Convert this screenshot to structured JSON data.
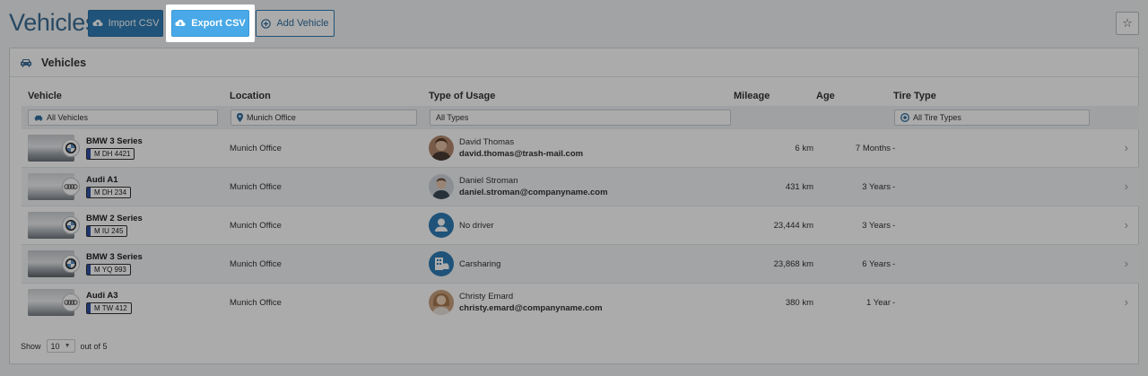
{
  "header": {
    "title": "Vehicles",
    "import_label": "Import CSV",
    "export_label": "Export CSV",
    "add_label": "Add Vehicle",
    "star_icon": "☆"
  },
  "panel": {
    "title": "Vehicles"
  },
  "columns": [
    "Vehicle",
    "Location",
    "Type of Usage",
    "Mileage",
    "Age",
    "Tire Type"
  ],
  "filters": {
    "vehicle": "All Vehicles",
    "location": "Munich Office",
    "usage": "All Types",
    "tire": "All Tire Types"
  },
  "rows": [
    {
      "name": "BMW 3 Series",
      "plate": "M DH 4421",
      "location": "Munich Office",
      "driver": "David Thomas",
      "email": "david.thomas@trash-mail.com",
      "mileage": "6 km",
      "age": "7 Months",
      "tire": "-"
    },
    {
      "name": "Audi A1",
      "plate": "M DH 234",
      "location": "Munich Office",
      "driver": "Daniel Stroman",
      "email": "daniel.stroman@companyname.com",
      "mileage": "431 km",
      "age": "3 Years",
      "tire": "-"
    },
    {
      "name": "BMW 2 Series",
      "plate": "M IU 245",
      "location": "Munich Office",
      "driver": "No driver",
      "email": "",
      "mileage": "23,444 km",
      "age": "3 Years",
      "tire": "-"
    },
    {
      "name": "BMW 3 Series",
      "plate": "M YQ 993",
      "location": "Munich Office",
      "driver": "Carsharing",
      "email": "",
      "mileage": "23,868 km",
      "age": "6 Years",
      "tire": "-"
    },
    {
      "name": "Audi A3",
      "plate": "M TW 412",
      "location": "Munich Office",
      "driver": "Christy Emard",
      "email": "christy.emard@companyname.com",
      "mileage": "380 km",
      "age": "1 Year",
      "tire": "-"
    }
  ],
  "footer": {
    "show_label": "Show",
    "page_size": "10",
    "out_of": "out of 5"
  },
  "colors": {
    "primary": "#2f7cb5",
    "export_accent": "#48a8e8",
    "title": "#3b6d96"
  }
}
